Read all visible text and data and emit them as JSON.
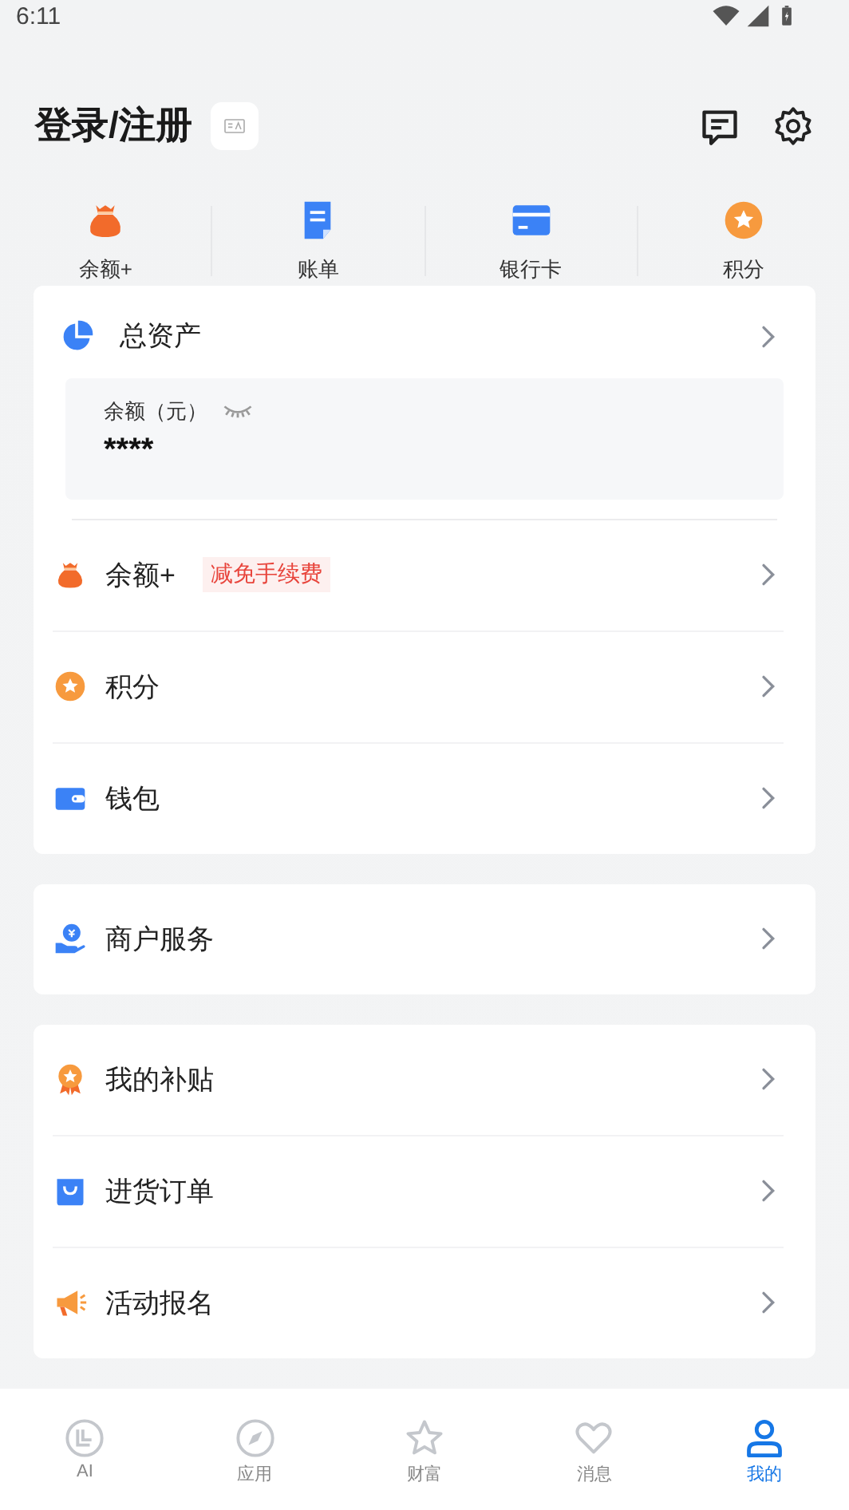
{
  "status_bar": {
    "time": "6:11"
  },
  "header": {
    "title": "登录/注册"
  },
  "shortcuts": [
    {
      "label": "余额+"
    },
    {
      "label": "账单"
    },
    {
      "label": "银行卡"
    },
    {
      "label": "积分"
    }
  ],
  "assets": {
    "title": "总资产",
    "balance_label": "余额（元）",
    "balance_value": "****"
  },
  "sections": [
    {
      "rows": [
        {
          "label": "余额+",
          "tag": "减免手续费"
        },
        {
          "label": "积分"
        },
        {
          "label": "钱包"
        }
      ]
    },
    {
      "rows": [
        {
          "label": "商户服务"
        }
      ]
    },
    {
      "rows": [
        {
          "label": "我的补贴"
        },
        {
          "label": "进货订单"
        },
        {
          "label": "活动报名"
        }
      ]
    }
  ],
  "nav": [
    {
      "label": "AI",
      "selected": false
    },
    {
      "label": "应用",
      "selected": false
    },
    {
      "label": "财富",
      "selected": false
    },
    {
      "label": "消息",
      "selected": false
    },
    {
      "label": "我的",
      "selected": true
    }
  ]
}
